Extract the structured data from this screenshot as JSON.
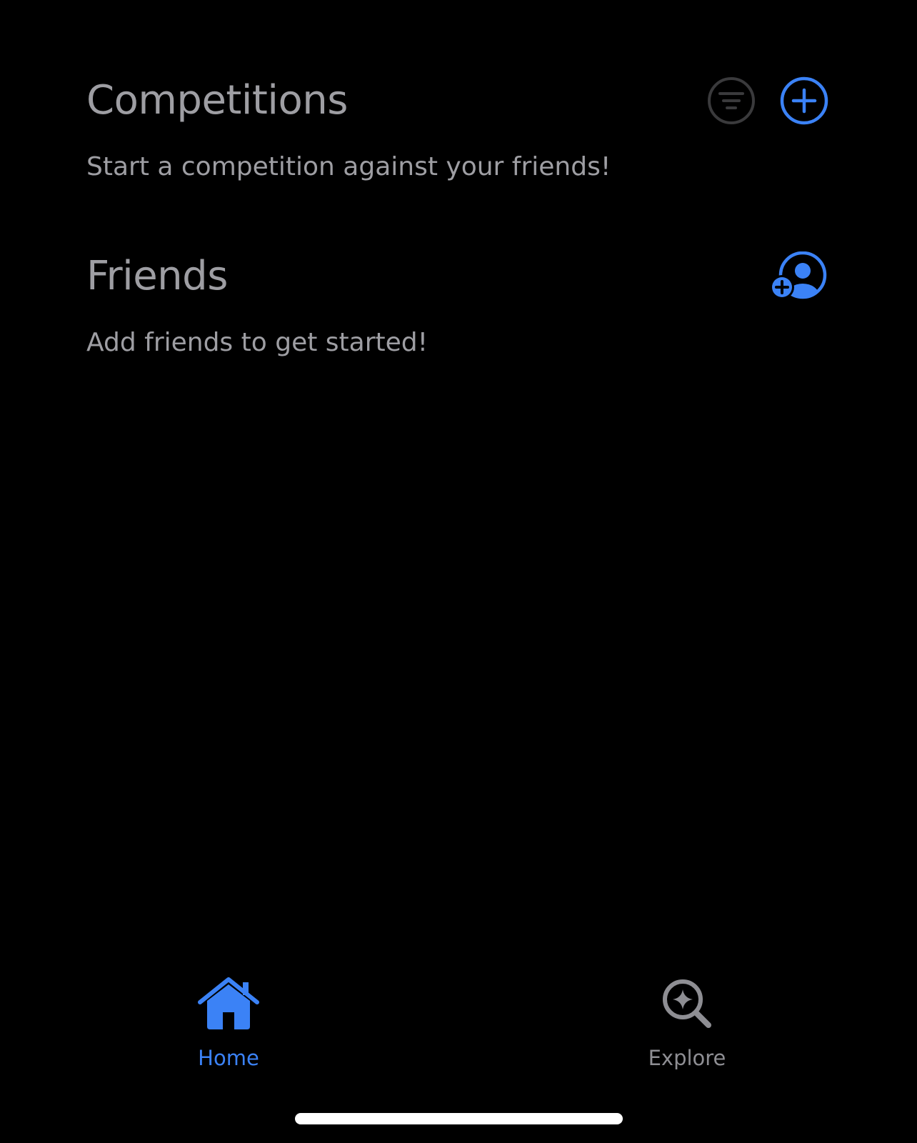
{
  "colors": {
    "background": "#000000",
    "accent": "#3b82f6",
    "text_secondary": "#9e9ea3",
    "icon_muted": "#3a3a3c"
  },
  "competitions": {
    "title": "Competitions",
    "subtitle": "Start a competition against your friends!",
    "filter_icon": "line-3-horizontal-decrease-circle-icon",
    "add_icon": "plus-circle-icon"
  },
  "friends": {
    "title": "Friends",
    "subtitle": "Add friends to get started!",
    "add_friend_icon": "person-crop-circle-badge-plus-icon"
  },
  "tab_bar": {
    "tabs": [
      {
        "label": "Home",
        "icon": "house-fill-icon",
        "active": true
      },
      {
        "label": "Explore",
        "icon": "sparkle-magnifyingglass-icon",
        "active": false
      }
    ]
  }
}
